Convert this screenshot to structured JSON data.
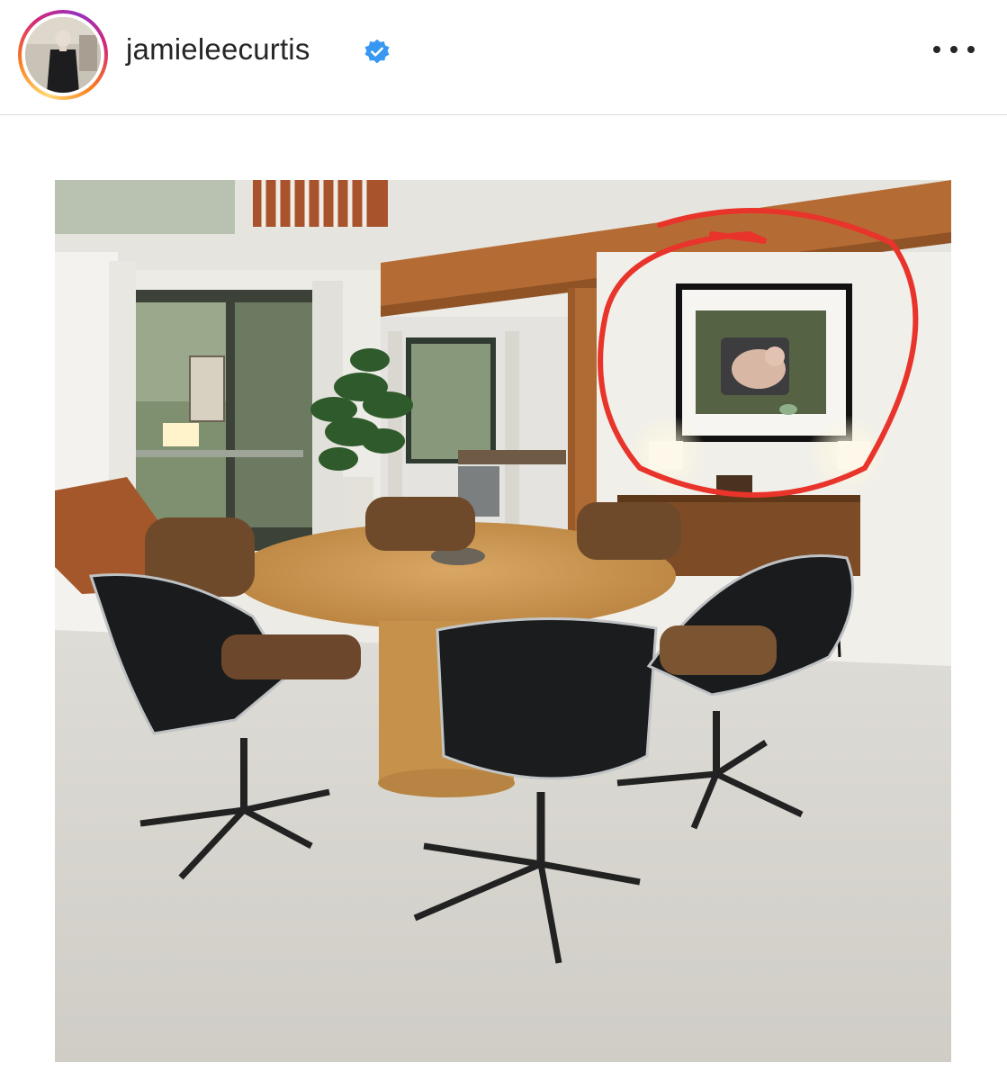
{
  "post": {
    "username": "jamieleecurtis",
    "verified": true,
    "avatar_icon": "profile-photo",
    "more_icon": "more-options-icon",
    "image_description_icon": "dining-room-photo",
    "annotation_color": "#e8342b"
  },
  "colors": {
    "verified_blue": "#3897f0",
    "text": "#262626",
    "divider": "#dbdbdb"
  }
}
